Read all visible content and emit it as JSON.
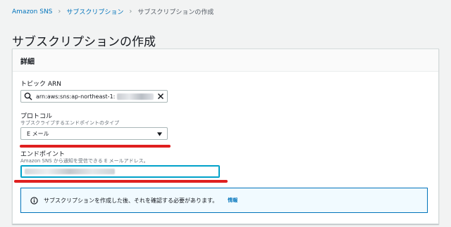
{
  "breadcrumb": {
    "items": [
      "Amazon SNS",
      "サブスクリプション",
      "サブスクリプションの作成"
    ]
  },
  "page": {
    "title": "サブスクリプションの作成"
  },
  "details": {
    "header": "詳細",
    "topic_arn": {
      "label": "トピック ARN",
      "value": "arn:aws:sns:ap-northeast-1:"
    },
    "protocol": {
      "label": "プロトコル",
      "description": "サブスクライブするエンドポイントのタイプ",
      "selected": "E メール"
    },
    "endpoint": {
      "label": "エンドポイント",
      "description": "Amazon SNS から通知を受信できる E メールアドレス。"
    },
    "info": {
      "message": "サブスクリプションを作成した後、それを確認する必要があります。",
      "link": "情報"
    }
  },
  "colors": {
    "link": "#0073bb",
    "focus": "#00a1c9",
    "annotation_red": "#e01f1f",
    "info_bg": "#f1faff"
  }
}
